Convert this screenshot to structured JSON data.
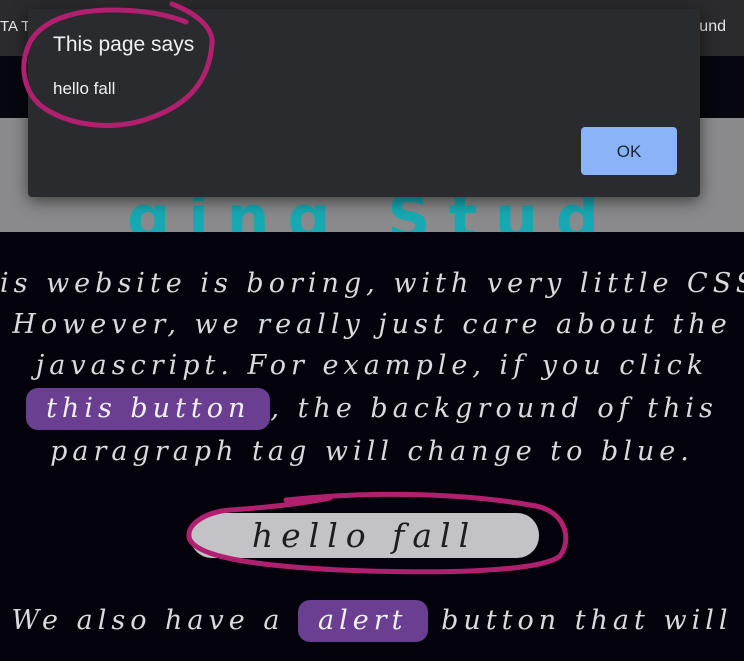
{
  "browser": {
    "tab_left_text": "TA T",
    "tab_right_text": "und"
  },
  "hero": {
    "partial_heading": "ging Stud"
  },
  "content": {
    "line1": "is website is boring, with very little CSS",
    "line2": "However, we really just care about the",
    "line3": "javascript. For example, if you click",
    "this_button_label": "this button",
    "line4_after": ", the background of this",
    "line5": "paragraph tag will change to blue.",
    "hello_button_label": "hello fall",
    "line6_before": "We also have a",
    "alert_button_label": "alert",
    "line6_after": "button that will"
  },
  "dialog": {
    "title": "This page says",
    "message": "hello fall",
    "ok_label": "OK"
  },
  "colors": {
    "page_bg": "#04030c",
    "purple_button": "#6a3f91",
    "grey_button": "#c3c2c6",
    "dialog_bg": "#2a2b2f",
    "ok_button": "#8ab4f7",
    "annotation": "#b0206e"
  }
}
